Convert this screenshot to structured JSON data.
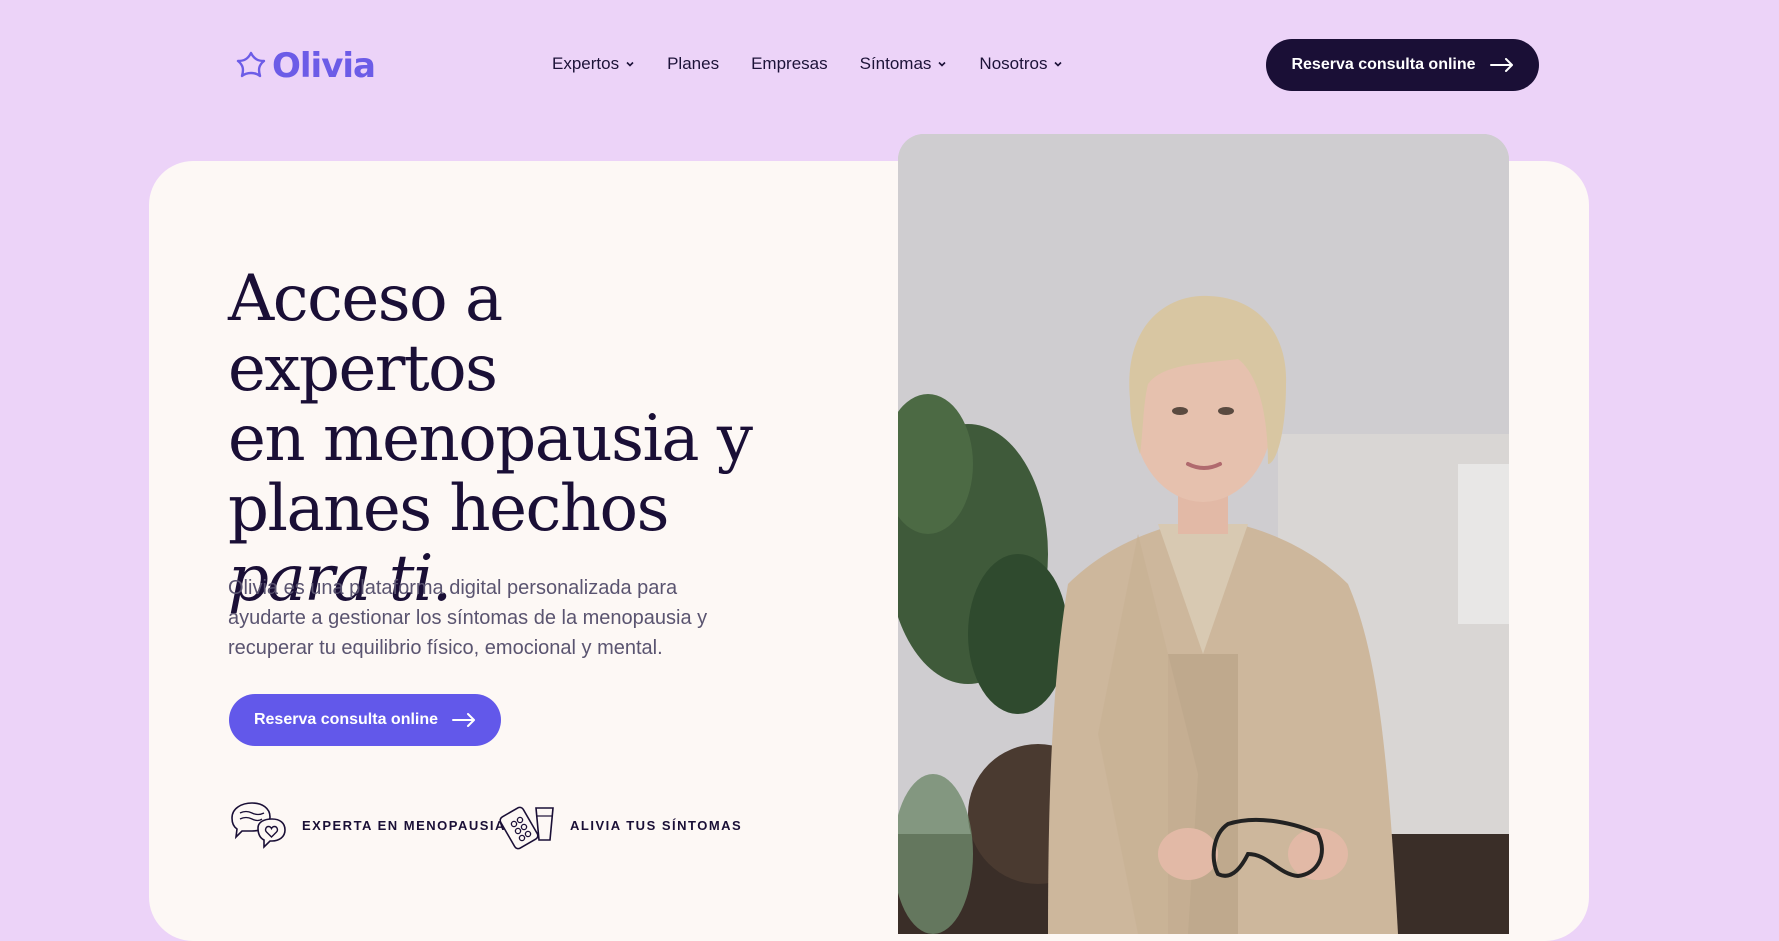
{
  "brand": {
    "name": "Olivia",
    "logo_icon": "flower-logo-icon",
    "color": "#6c5ce7"
  },
  "nav": {
    "items": [
      {
        "label": "Expertos",
        "has_dropdown": true
      },
      {
        "label": "Planes",
        "has_dropdown": false
      },
      {
        "label": "Empresas",
        "has_dropdown": false
      },
      {
        "label": "Síntomas",
        "has_dropdown": true
      },
      {
        "label": "Nosotros",
        "has_dropdown": true
      }
    ]
  },
  "header": {
    "cta_label": "Reserva consulta online"
  },
  "hero": {
    "headline_line1": "Acceso a expertos",
    "headline_line2": "en menopausia y",
    "headline_line3": "planes hechos",
    "headline_emphasis": "para ti.",
    "lede": "Olivia es una plataforma digital personalizada para ayudarte a gestionar los síntomas de la menopausia y recuperar tu equilibrio físico, emocional y mental.",
    "cta_label": "Reserva consulta online"
  },
  "features": [
    {
      "label": "EXPERTA EN MENOPAUSIA",
      "icon": "chat-bubbles-heart-icon"
    },
    {
      "label": "ALIVIA TUS SÍNTOMAS",
      "icon": "pills-glass-icon"
    }
  ],
  "colors": {
    "background": "#ecd3f8",
    "card": "#fdf8f5",
    "dark": "#1a0f36",
    "accent": "#6258ea"
  }
}
